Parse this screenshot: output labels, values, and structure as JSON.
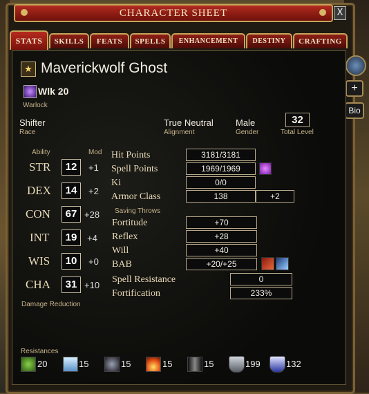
{
  "window": {
    "title": "CHARACTER SHEET",
    "close_label": "X"
  },
  "tabs": [
    {
      "label": "STATS",
      "active": true
    },
    {
      "label": "SKILLS"
    },
    {
      "label": "FEATS"
    },
    {
      "label": "SPELLS"
    },
    {
      "label": "ENHANCEMENT"
    },
    {
      "label": "DESTINY"
    },
    {
      "label": "CRAFTING"
    }
  ],
  "side_buttons": {
    "plus": "+",
    "bio": "Bio"
  },
  "character": {
    "name": "Maverickwolf Ghost",
    "class_short": "Wlk 20",
    "class_name": "Warlock",
    "race": "Shifter",
    "race_label": "Race",
    "alignment": "True Neutral",
    "alignment_label": "Alignment",
    "gender": "Male",
    "gender_label": "Gender",
    "total_level": "32",
    "total_level_label": "Total Level"
  },
  "abilities_header": {
    "ability": "Ability",
    "mod": "Mod"
  },
  "abilities": [
    {
      "name": "STR",
      "value": "12",
      "mod": "+1"
    },
    {
      "name": "DEX",
      "value": "14",
      "mod": "+2"
    },
    {
      "name": "CON",
      "value": "67",
      "mod": "+28"
    },
    {
      "name": "INT",
      "value": "19",
      "mod": "+4"
    },
    {
      "name": "WIS",
      "value": "10",
      "mod": "+0"
    },
    {
      "name": "CHA",
      "value": "31",
      "mod": "+10"
    }
  ],
  "damage_reduction_label": "Damage Reduction",
  "stats": {
    "hit_points_label": "Hit Points",
    "hit_points": "3181/3181",
    "spell_points_label": "Spell Points",
    "spell_points": "1969/1969",
    "ki_label": "Ki",
    "ki": "0/0",
    "armor_class_label": "Armor Class",
    "armor_class": "138",
    "armor_class_bonus": "+2",
    "saving_throws_label": "Saving Throws",
    "fortitude_label": "Fortitude",
    "fortitude": "+70",
    "reflex_label": "Reflex",
    "reflex": "+28",
    "will_label": "Will",
    "will": "+40",
    "bab_label": "BAB",
    "bab": "+20/+25",
    "spell_resistance_label": "Spell Resistance",
    "spell_resistance": "0",
    "fortification_label": "Fortification",
    "fortification": "233%"
  },
  "resistances_label": "Resistances",
  "resistances": [
    {
      "icon": "acid-icon",
      "value": "20",
      "color": "#4c8a28"
    },
    {
      "icon": "cold-icon",
      "value": "15",
      "color": "#7fb4de"
    },
    {
      "icon": "electric-icon",
      "value": "15",
      "color": "#3a3a44"
    },
    {
      "icon": "fire-icon",
      "value": "15",
      "color": "#d2611b"
    },
    {
      "icon": "sonic-icon",
      "value": "15",
      "color": "#555555"
    },
    {
      "icon": "physical-shield-icon",
      "value": "199",
      "color": "#8a8f98"
    },
    {
      "icon": "magic-shield-icon",
      "value": "132",
      "color": "#3340a0"
    }
  ],
  "colors": {
    "title_red": "#b22a1e",
    "gold_border": "#c7a55a",
    "label_tan": "#e7d8b6"
  }
}
